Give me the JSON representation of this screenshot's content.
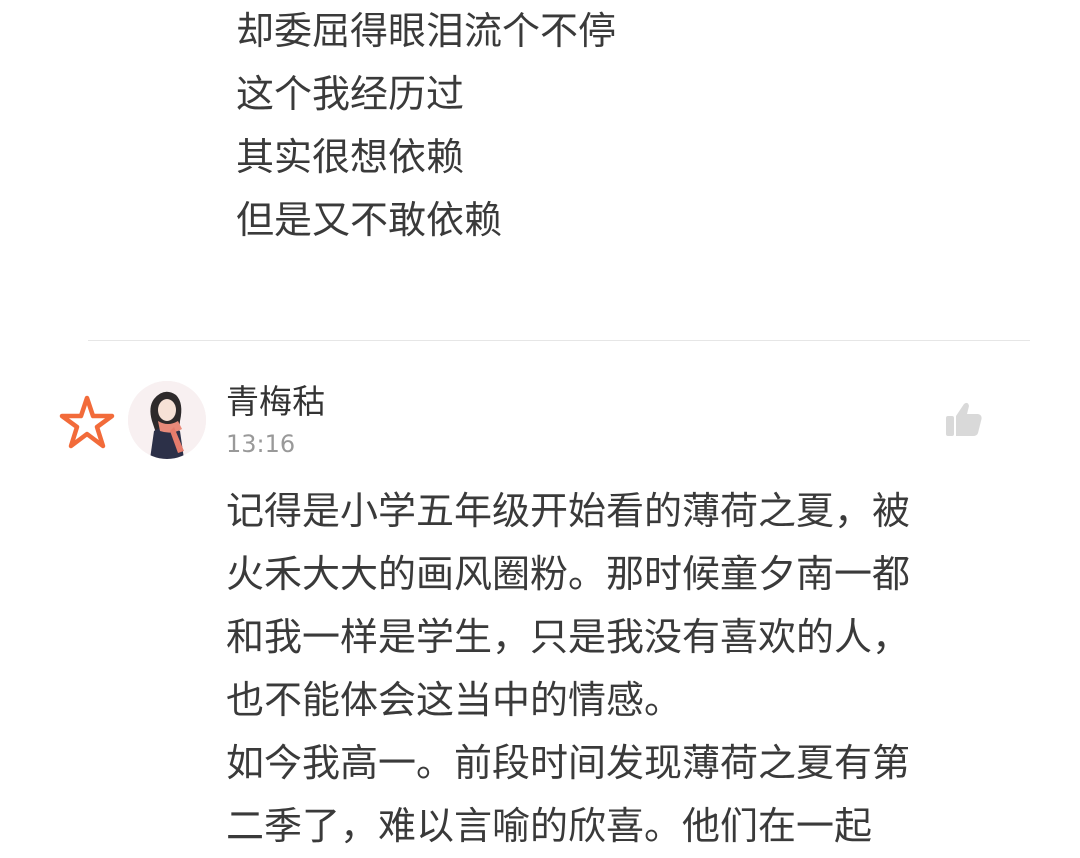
{
  "previous_comment": {
    "lines": [
      "却委屈得眼泪流个不停",
      "这个我经历过",
      "其实很想依赖",
      "但是又不敢依赖"
    ]
  },
  "comment": {
    "username": "青梅秙",
    "time": "13:16",
    "badge_icon": "star-badge-icon",
    "badge_color": "#f26b3a",
    "like_icon": "thumbs-up-icon",
    "like_color": "#d9d9d9",
    "lines": [
      "记得是小学五年级开始看的薄荷之夏，被",
      "火禾大大的画风圈粉。那时候童夕南一都",
      "和我一样是学生，只是我没有喜欢的人，",
      "也不能体会这当中的情感。",
      "如今我高一。前段时间发现薄荷之夏有第",
      "二季了，难以言喻的欣喜。他们在一起"
    ]
  }
}
